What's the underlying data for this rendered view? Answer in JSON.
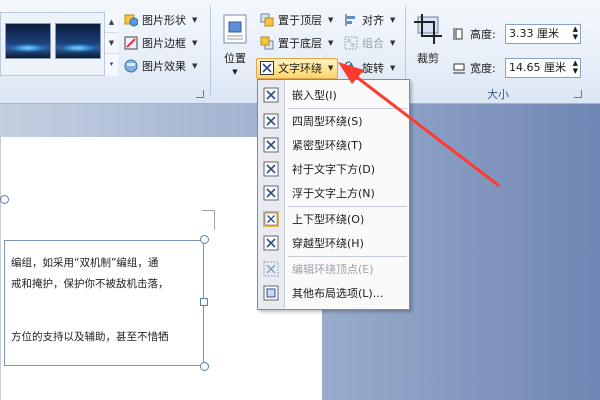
{
  "ribbon": {
    "picture_shape": "图片形状",
    "picture_border": "图片边框",
    "picture_effects": "图片效果",
    "position": "位置",
    "bring_front": "置于顶层",
    "send_back": "置于底层",
    "text_wrap": "文字环绕",
    "align": "对齐",
    "group": "组合",
    "rotate": "旋转",
    "crop": "裁剪",
    "height_label": "高度:",
    "height_value": "3.33 厘米",
    "width_label": "宽度:",
    "width_value": "14.65 厘米",
    "size_group": "大小"
  },
  "menu": {
    "items": [
      {
        "label": "嵌入型(I)",
        "icon": "inline-wrap-icon"
      },
      {
        "label": "四周型环绕(S)",
        "icon": "square-wrap-icon"
      },
      {
        "label": "紧密型环绕(T)",
        "icon": "tight-wrap-icon"
      },
      {
        "label": "衬于文字下方(D)",
        "icon": "behind-text-icon"
      },
      {
        "label": "浮于文字上方(N)",
        "icon": "in-front-text-icon"
      },
      {
        "label": "上下型环绕(O)",
        "icon": "top-bottom-wrap-icon"
      },
      {
        "label": "穿越型环绕(H)",
        "icon": "through-wrap-icon"
      },
      {
        "label": "编辑环绕顶点(E)",
        "icon": "edit-wrap-points-icon"
      },
      {
        "label": "其他布局选项(L)...",
        "icon": "more-layout-icon"
      }
    ]
  },
  "document": {
    "line1": "编组，如采用“双机制”编组，通",
    "line2": "戒和掩护，保护你不被敌机击落，",
    "line3": "方位的支持以及辅助，甚至不惜牺"
  },
  "colors": {
    "accent": "#ff3b30",
    "ribbon_label": "#3c5a88",
    "highlight": "#ffd56a"
  }
}
